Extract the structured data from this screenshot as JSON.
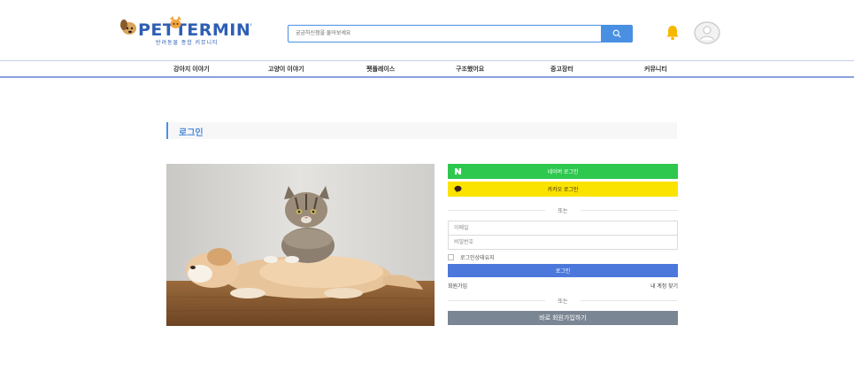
{
  "header": {
    "logo_text": "PETTERMINT",
    "logo_subtitle": "반려동물 종합 커뮤니티",
    "search_placeholder": "궁금하신점을 물어보세요",
    "search_icon": "search-icon",
    "bell_icon": "bell-icon",
    "avatar_icon": "user-avatar-icon"
  },
  "nav": {
    "items": [
      {
        "label": "강아지 이야기"
      },
      {
        "label": "고양이 이야기"
      },
      {
        "label": "펫플레이스"
      },
      {
        "label": "구조했어요"
      },
      {
        "label": "중고장터"
      },
      {
        "label": "커뮤니티"
      }
    ]
  },
  "login": {
    "title": "로그인",
    "naver_label": "네이버 로그인",
    "naver_icon": "naver-n-icon",
    "kakao_label": "카카오 로그인",
    "kakao_icon": "kakao-chat-icon",
    "or_label_1": "또는",
    "email_placeholder": "이메일",
    "password_placeholder": "비밀번호",
    "keep_logged_in": "로그인상태유지",
    "login_button": "로그인",
    "signup_link": "회원가입",
    "find_account_link": "내 계정 찾기",
    "or_label_2": "또는",
    "quick_signup_button": "바로 회원가입하기"
  },
  "colors": {
    "accent": "#4a90e2",
    "naver": "#2ec84f",
    "kakao": "#fbe300",
    "login_button": "#4c78db",
    "quick_signup": "#7b8694",
    "bell": "#f5b800"
  }
}
